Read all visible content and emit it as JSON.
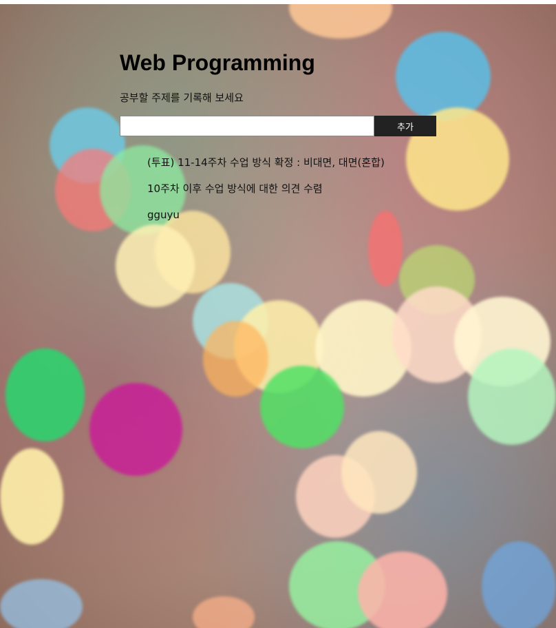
{
  "header": {
    "title": "Web Programming",
    "subtitle": "공부할 주제를 기록해 보세요"
  },
  "form": {
    "input_value": "",
    "input_placeholder": "",
    "add_label": "추가"
  },
  "topics": [
    "(투표) 11-14주차 수업 방식 확정 : 비대면, 대면(혼합)",
    "10주차 이후 수업 방식에 대한 의견 수렴",
    "gguyu"
  ]
}
